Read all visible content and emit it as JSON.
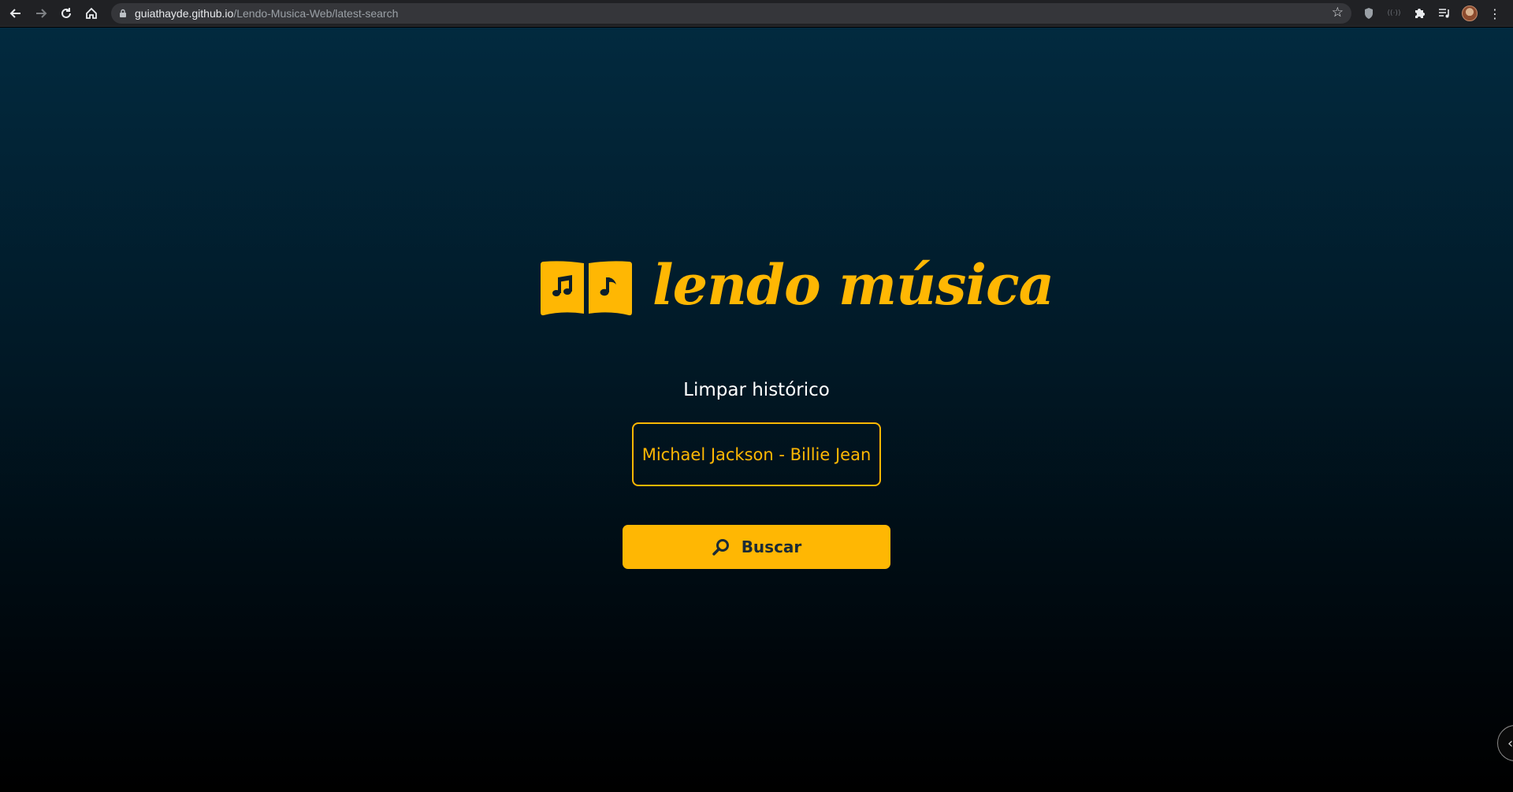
{
  "browser": {
    "url_host": "guiathayde.github.io",
    "url_path": "/Lendo-Musica-Web/latest-search"
  },
  "icons": {
    "back": "back-arrow-icon",
    "forward": "forward-arrow-icon",
    "reload": "reload-icon",
    "home": "home-icon",
    "lock": "lock-icon",
    "star": "bookmark-star-icon",
    "shield": "shield-extension-icon",
    "extensions": "puzzle-icon",
    "media": "media-control-icon",
    "menu": "kebab-menu-icon",
    "logo": "open-book-music-icon",
    "search": "magnifier-icon"
  },
  "app": {
    "logo_text": "lendo música",
    "clear_history_label": "Limpar histórico",
    "history": [
      {
        "label": "Michael Jackson - Billie Jean"
      }
    ],
    "search_button_label": "Buscar"
  },
  "colors": {
    "accent": "#ffb703",
    "background_top": "#022a3f",
    "background_bottom": "#000000",
    "button_text": "#1b2b36"
  }
}
